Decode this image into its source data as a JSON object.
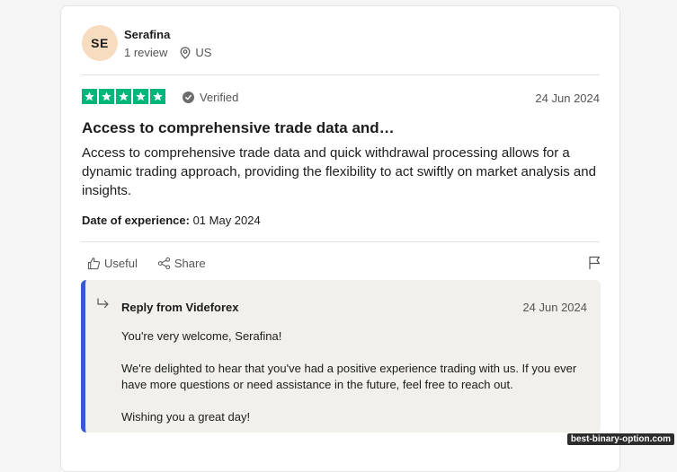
{
  "reviewer": {
    "initials": "SE",
    "name": "Serafina",
    "reviews": "1 review",
    "location": "US"
  },
  "review": {
    "stars": 5,
    "verified_label": "Verified",
    "date": "24 Jun 2024",
    "title": "Access to comprehensive trade data and…",
    "body": "Access to comprehensive trade data and quick withdrawal processing allows for a dynamic trading approach, providing the flexibility to act swiftly on market analysis and insights.",
    "experience_label": "Date of experience:",
    "experience_date": "01 May 2024"
  },
  "actions": {
    "useful_label": "Useful",
    "share_label": "Share"
  },
  "reply": {
    "from": "Reply from Videforex",
    "date": "24 Jun 2024",
    "paragraphs": [
      "You're very welcome, Serafina!",
      "We're delighted to hear that you've had a positive experience trading with us. If you ever have more questions or need assistance in the future, feel free to reach out.",
      "Wishing you a great day!"
    ]
  },
  "watermark": "best-binary-option.com",
  "colors": {
    "star_green": "#00b67a",
    "reply_accent": "#3558d6",
    "reply_bg": "#f1f0ea",
    "avatar_bg": "#f8dcc0"
  }
}
